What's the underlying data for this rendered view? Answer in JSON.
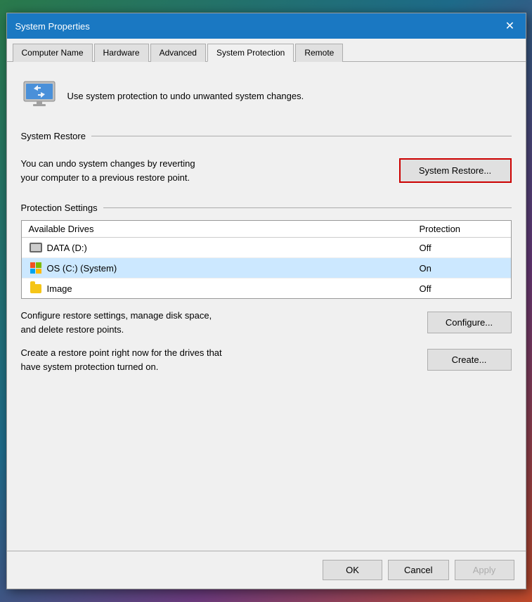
{
  "dialog": {
    "title": "System Properties",
    "close_label": "✕"
  },
  "tabs": [
    {
      "id": "computer-name",
      "label": "Computer Name",
      "active": false
    },
    {
      "id": "hardware",
      "label": "Hardware",
      "active": false
    },
    {
      "id": "advanced",
      "label": "Advanced",
      "active": false
    },
    {
      "id": "system-protection",
      "label": "System Protection",
      "active": true
    },
    {
      "id": "remote",
      "label": "Remote",
      "active": false
    }
  ],
  "info": {
    "text": "Use system protection to undo unwanted system changes."
  },
  "system_restore_section": {
    "title": "System Restore",
    "description": "You can undo system changes by reverting\nyour computer to a previous restore point.",
    "button_label": "System Restore..."
  },
  "protection_section": {
    "title": "Protection Settings",
    "columns": {
      "drive": "Available Drives",
      "protection": "Protection"
    },
    "drives": [
      {
        "id": "data-d",
        "name": "DATA (D:)",
        "protection": "Off",
        "icon": "hdd",
        "selected": false
      },
      {
        "id": "os-c",
        "name": "OS (C:) (System)",
        "protection": "On",
        "icon": "windows",
        "selected": true
      },
      {
        "id": "image",
        "name": "Image",
        "protection": "Off",
        "icon": "folder",
        "selected": false
      }
    ]
  },
  "configure_row": {
    "text": "Configure restore settings, manage disk space,\nand delete restore points.",
    "button_label": "Configure..."
  },
  "create_row": {
    "text": "Create a restore point right now for the drives that\nhave system protection turned on.",
    "button_label": "Create..."
  },
  "footer": {
    "ok_label": "OK",
    "cancel_label": "Cancel",
    "apply_label": "Apply"
  }
}
